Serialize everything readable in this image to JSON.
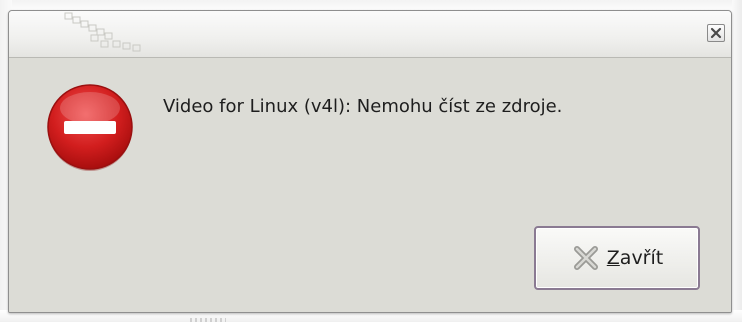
{
  "dialog": {
    "message": "Video for Linux (v4l): Nemohu číst ze zdroje.",
    "icon": "error-stop-icon",
    "close_button": {
      "mnemonic": "Z",
      "label_rest": "avřít",
      "icon": "x-close-icon"
    },
    "titlebar": {
      "close_icon": "window-close-icon"
    }
  },
  "colors": {
    "dialog_background": "#dcdcd6",
    "error_red": "#d21e1e",
    "button_border": "#8a7a92"
  }
}
